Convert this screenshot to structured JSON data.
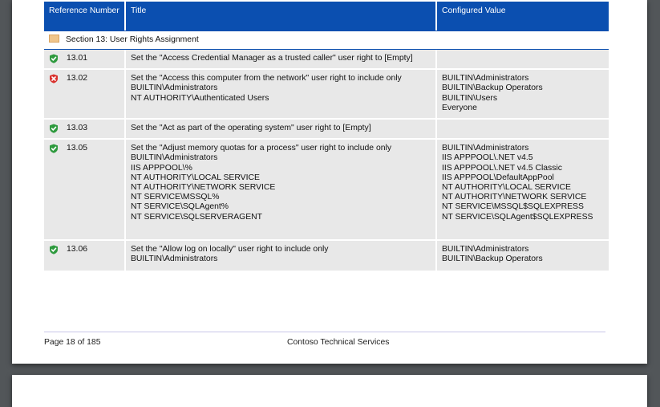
{
  "table": {
    "headers": {
      "reference": "Reference Number",
      "title": "Title",
      "value": "Configured Value"
    },
    "section": {
      "label": "Section 13: User Rights Assignment",
      "icon": "folder-icon"
    },
    "rows": [
      {
        "status": "pass",
        "ref": "13.01",
        "title": [
          "Set the \"Access Credential Manager as a trusted caller\" user right to [Empty]"
        ],
        "value": []
      },
      {
        "status": "fail",
        "ref": "13.02",
        "title": [
          "Set the \"Access this computer from the network\" user right to include only",
          "BUILTIN\\Administrators",
          "NT AUTHORITY\\Authenticated Users"
        ],
        "value": [
          "BUILTIN\\Administrators",
          "BUILTIN\\Backup Operators",
          "BUILTIN\\Users",
          "Everyone"
        ]
      },
      {
        "status": "pass",
        "ref": "13.03",
        "title": [
          "Set the \"Act as part of the operating system\" user right to [Empty]"
        ],
        "value": []
      },
      {
        "status": "pass",
        "ref": "13.05",
        "title": [
          "Set the \"Adjust memory quotas for a process\" user right to include only",
          "BUILTIN\\Administrators",
          "IIS APPPOOL\\%",
          "NT AUTHORITY\\LOCAL SERVICE",
          "NT AUTHORITY\\NETWORK SERVICE",
          "NT SERVICE\\MSSQL%",
          "NT SERVICE\\SQLAgent%",
          "NT SERVICE\\SQLSERVERAGENT"
        ],
        "value": [
          "BUILTIN\\Administrators",
          "IIS APPPOOL\\.NET v4.5",
          "IIS APPPOOL\\.NET v4.5 Classic",
          "IIS APPPOOL\\DefaultAppPool",
          "NT AUTHORITY\\LOCAL SERVICE",
          "NT AUTHORITY\\NETWORK SERVICE",
          "NT SERVICE\\MSSQL$SQLEXPRESS",
          "NT SERVICE\\SQLAgent$SQLEXPRESS"
        ]
      },
      {
        "status": "pass",
        "ref": "13.06",
        "title": [
          "Set the \"Allow log on locally\" user right to include only",
          "BUILTIN\\Administrators"
        ],
        "value": [
          "BUILTIN\\Administrators",
          "BUILTIN\\Backup Operators"
        ]
      }
    ]
  },
  "footer": {
    "page": "Page 18 of 185",
    "company": "Contoso Technical Services"
  },
  "colors": {
    "header_bg": "#0b4fb0",
    "pass": "#2e9a3e",
    "fail": "#d9302c",
    "row_bg": "#e8e8e8"
  }
}
